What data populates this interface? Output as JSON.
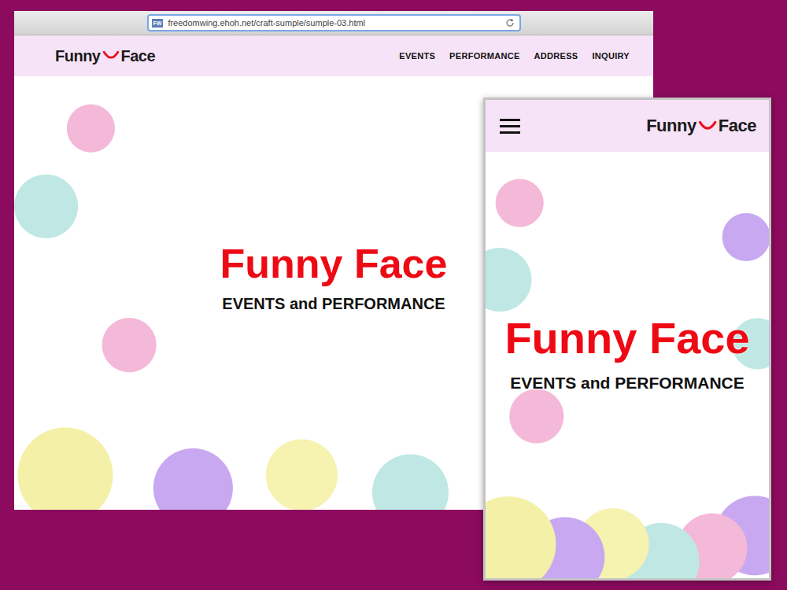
{
  "browser": {
    "favicon": "FW",
    "url": "freedomwing.ehoh.net/craft-sumple/sumple-03.html"
  },
  "desktop": {
    "logo": {
      "left": "Funny",
      "right": "Face"
    },
    "nav": [
      "EVENTS",
      "PERFORMANCE",
      "ADDRESS",
      "INQUIRY"
    ],
    "hero": {
      "title": "Funny Face",
      "subtitle": "EVENTS and PERFORMANCE"
    }
  },
  "mobile": {
    "logo": {
      "left": "Funny",
      "right": "Face"
    },
    "hero": {
      "title": "Funny Face",
      "subtitle": "EVENTS and PERFORMANCE"
    }
  }
}
